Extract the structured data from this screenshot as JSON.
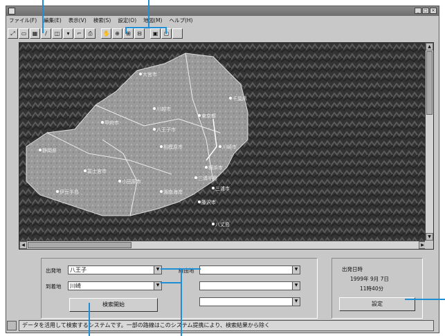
{
  "window": {
    "title": "",
    "controls": [
      "_",
      "□",
      "×"
    ]
  },
  "menu": [
    "ファイル(F)",
    "編集(E)",
    "表示(V)",
    "検索(S)",
    "設定(O)",
    "地図(M)",
    "ヘルプ(H)"
  ],
  "toolbar": {
    "group1": [
      "zoom-in-tool",
      "select-tool",
      "table-tool",
      "pen-tool",
      "route-tool",
      "down-tool",
      "plot-tool",
      "print-tool"
    ],
    "group2": [
      "hand-tool",
      "zoom-tool-1",
      "zoom-tool-2",
      "zoom-tool-3"
    ],
    "group3": [
      "save-tool",
      "window-tool",
      "blank-tool"
    ]
  },
  "map": {
    "labels": [
      "大宮市",
      "甲府市",
      "川越市",
      "相模原市",
      "川崎市",
      "八王子市",
      "横浜市",
      "東京都",
      "三浦市",
      "湘南海岸",
      "静岡県",
      "富士宮市",
      "伊豆半島",
      "三浦半島",
      "八丈島",
      "小田原市",
      "藤沢市",
      "千葉県"
    ]
  },
  "search_panel": {
    "departure_label": "出発地",
    "departure_value": "八王子",
    "destination_label": "到着地",
    "destination_value": "川崎",
    "via_label": "経由地",
    "via_values": [
      "",
      "",
      ""
    ],
    "start_button": "検索開始"
  },
  "time_panel": {
    "heading": "出発日時",
    "date": "1999年 9月 7日",
    "time": "11時40分",
    "set_button": "設定"
  },
  "status_bar": "データを活用して検索するシステムです。一部の路線はこのシステム提携により、検索結果から除く"
}
